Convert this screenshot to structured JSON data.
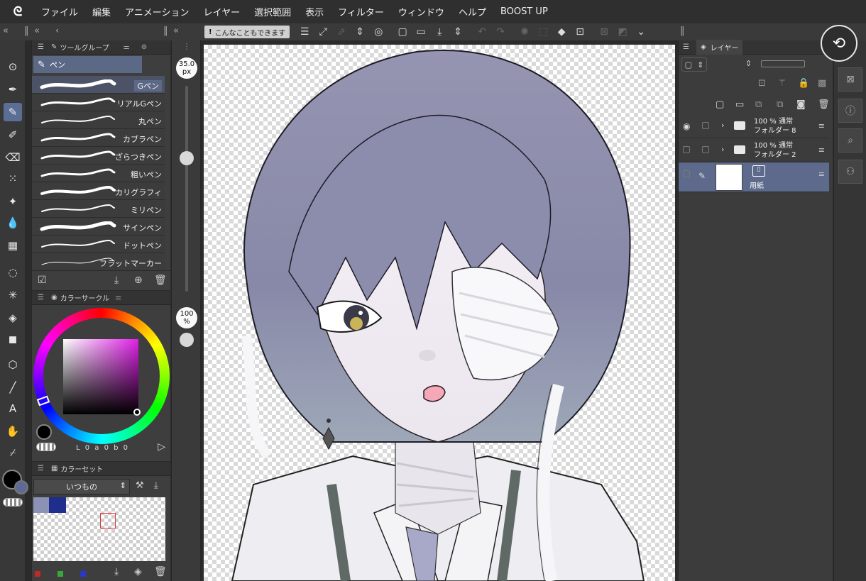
{
  "menubar": {
    "items": [
      "ファイル",
      "編集",
      "アニメーション",
      "レイヤー",
      "選択範囲",
      "表示",
      "フィルター",
      "ウィンドウ",
      "ヘルプ",
      "BOOST UP"
    ]
  },
  "tool_panel": {
    "title": "ツールグループ",
    "group_label": "ペン",
    "brushes": [
      "Gペン",
      "リアルGペン",
      "丸ペン",
      "カブラペン",
      "ざらつきペン",
      "粗いペン",
      "カリグラフィ",
      "ミリペン",
      "サインペン",
      "ドットペン",
      "フラットマーカー"
    ],
    "active_brush": "Gペン"
  },
  "size_slider": {
    "value": "35.0",
    "unit": "px",
    "position": 0.35
  },
  "opacity_slider": {
    "value": "100",
    "unit": "%"
  },
  "color_circle": {
    "title": "カラーサークル",
    "hue_color": "#e020e8",
    "readout": "L 0 a 0 b 0"
  },
  "color_set": {
    "title": "カラーセット",
    "selected_set": "いつもの",
    "swatches": [
      "#8b92b6",
      "#1f2d8c"
    ]
  },
  "command_bar": {
    "tip": "こんなこともできます"
  },
  "layer_panel": {
    "title": "レイヤー",
    "layers": [
      {
        "opacity": "100 % 通常",
        "name": "フォルダー 8",
        "visible": true
      },
      {
        "opacity": "100 % 通常",
        "name": "フォルダー 2",
        "visible": false
      },
      {
        "name": "用紙",
        "active": true
      }
    ]
  },
  "colors": {
    "accent": "#5e6a8c",
    "panel": "#3c3c3c",
    "hair": "#8a8aa6"
  }
}
